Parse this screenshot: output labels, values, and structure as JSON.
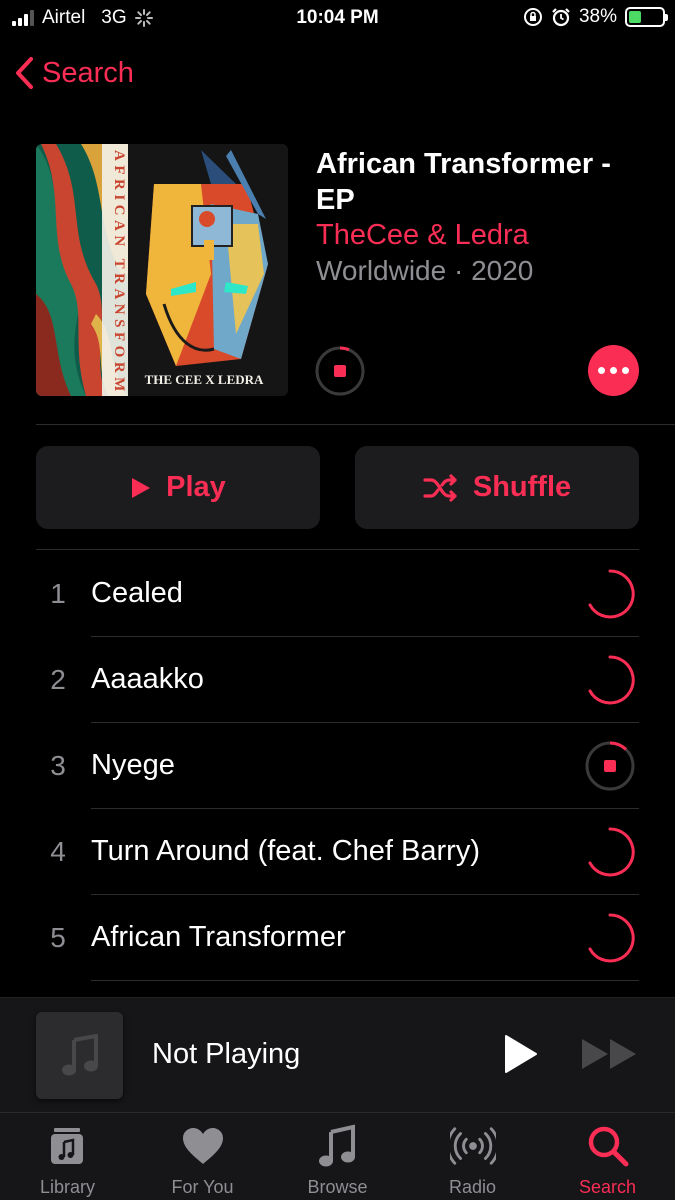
{
  "status_bar": {
    "carrier": "Airtel",
    "network": "3G",
    "time": "10:04 PM",
    "battery": "38%",
    "battery_level": 0.38
  },
  "nav": {
    "back_label": "Search"
  },
  "album": {
    "title": "African Transformer - EP",
    "artist": "TheCee & Ledra",
    "meta": "Worldwide · 2020",
    "art_lines": [
      "AFRICAN TRANSFORMER",
      "THE CEE X LEDRA"
    ]
  },
  "actions": {
    "play_label": "Play",
    "shuffle_label": "Shuffle"
  },
  "tracks": [
    {
      "number": "1",
      "title": "Cealed",
      "state": "downloading"
    },
    {
      "number": "2",
      "title": "Aaaakko",
      "state": "downloading"
    },
    {
      "number": "3",
      "title": "Nyege",
      "state": "download-stop"
    },
    {
      "number": "4",
      "title": "Turn Around (feat. Chef Barry)",
      "state": "downloading"
    },
    {
      "number": "5",
      "title": "African Transformer",
      "state": "downloading"
    }
  ],
  "mini_player": {
    "label": "Not Playing"
  },
  "tabs": [
    {
      "label": "Library",
      "icon": "library-icon",
      "active": false
    },
    {
      "label": "For You",
      "icon": "heart-icon",
      "active": false
    },
    {
      "label": "Browse",
      "icon": "music-note-icon",
      "active": false
    },
    {
      "label": "Radio",
      "icon": "radio-icon",
      "active": false
    },
    {
      "label": "Search",
      "icon": "search-icon",
      "active": true
    }
  ],
  "colors": {
    "accent": "#fa2d55",
    "secondary_text": "#8e8e93",
    "background": "#000000",
    "surface": "#1c1c1e"
  }
}
